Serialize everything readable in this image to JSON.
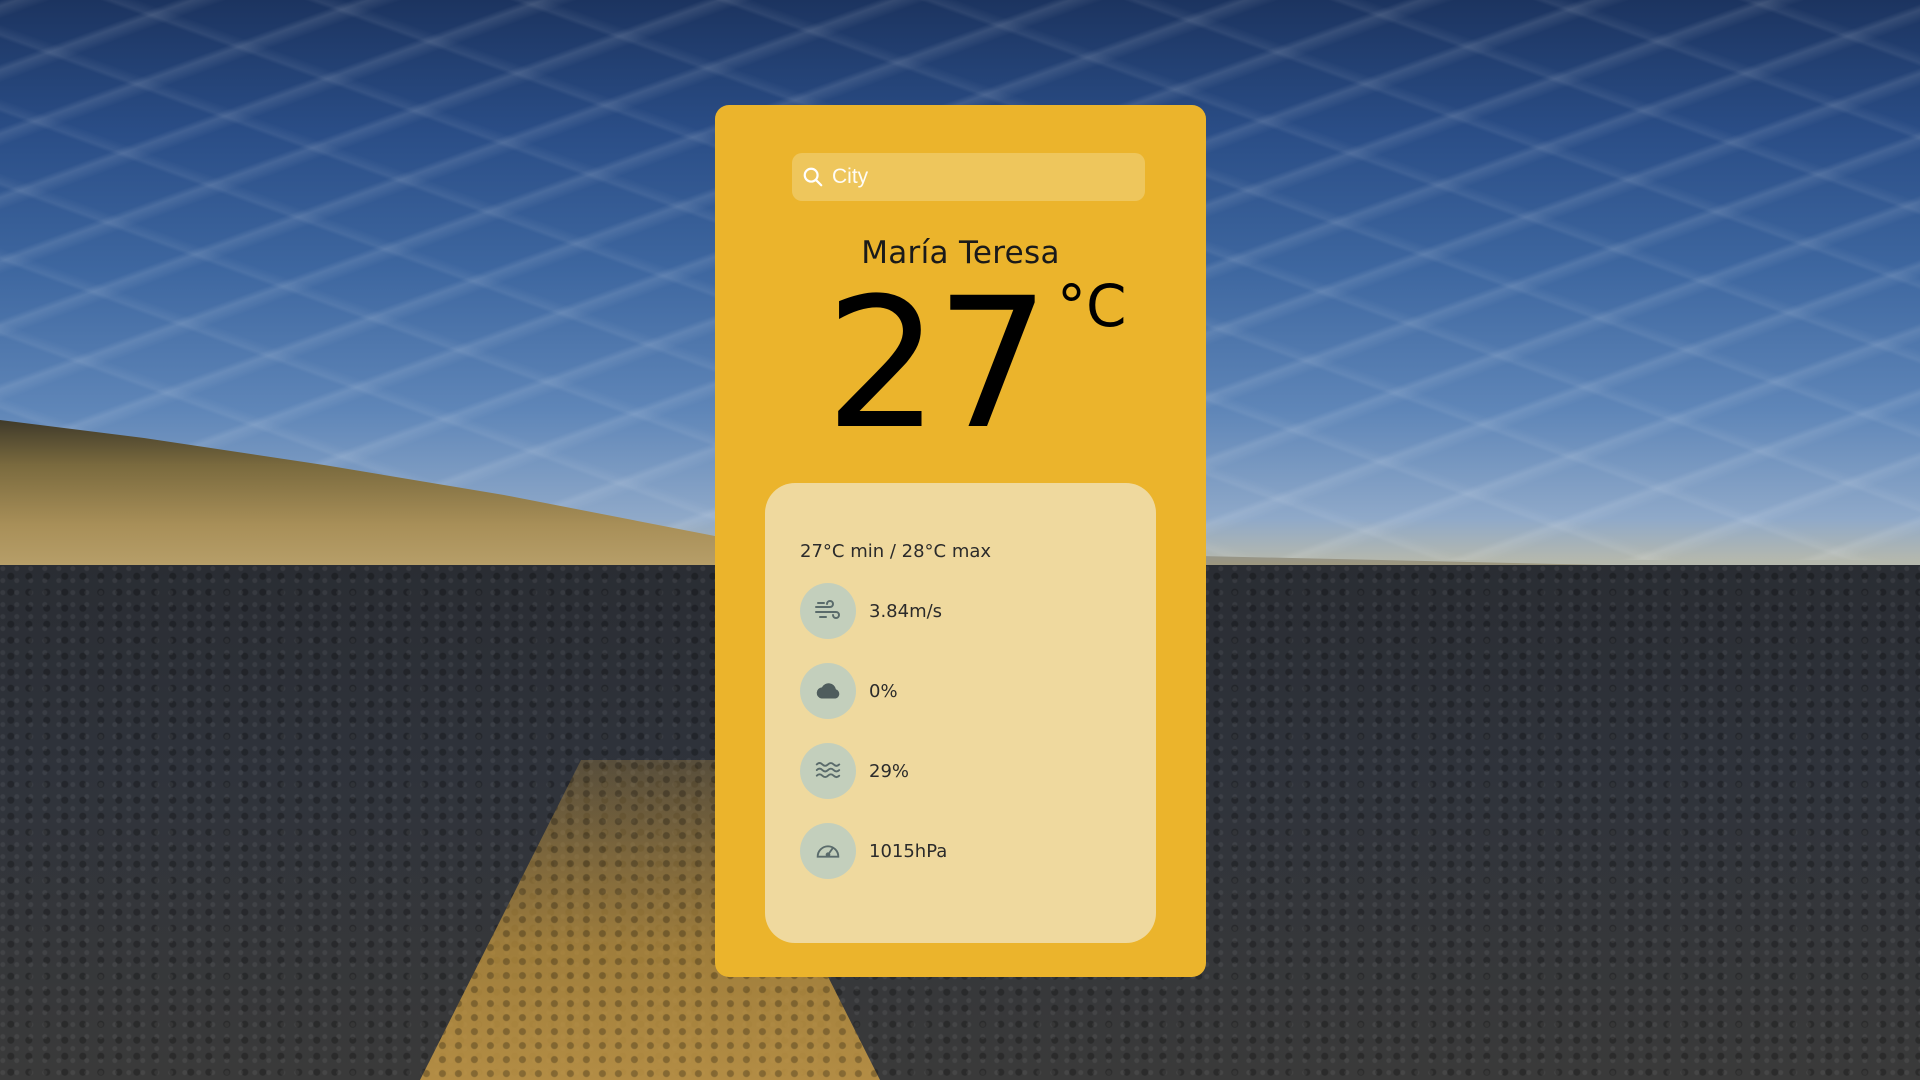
{
  "search": {
    "placeholder": "City"
  },
  "weather": {
    "city": "María Teresa",
    "temperature": "27",
    "unit": "°C",
    "min_max": "27°C min / 28°C max",
    "details": [
      {
        "icon": "wind-icon",
        "value": "3.84m/s"
      },
      {
        "icon": "cloud-icon",
        "value": "0%"
      },
      {
        "icon": "humidity-icon",
        "value": "29%"
      },
      {
        "icon": "pressure-gauge-icon",
        "value": "1015hPa"
      }
    ]
  },
  "colors": {
    "card": "#ebb42c",
    "search_bg": "#eec65c",
    "details_bg": "#efd99e",
    "icon_circle": "#c3cfbc",
    "icon_stroke": "#5a6b6b"
  }
}
